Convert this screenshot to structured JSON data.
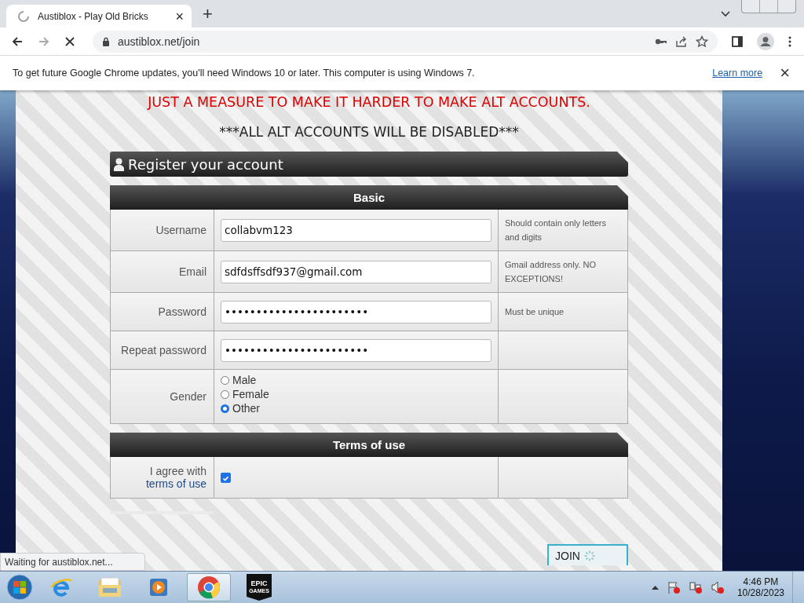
{
  "browser": {
    "tab": {
      "title": "Austiblox - Play Old Bricks",
      "loading": true,
      "close": "×"
    },
    "new_tab": "+",
    "url": "austiblox.net/join",
    "loading": true
  },
  "infobar": {
    "message": "To get future Google Chrome updates, you'll need Windows 10 or later. This computer is using Windows 7.",
    "link": "Learn more",
    "close": "×"
  },
  "page": {
    "notice_lines": [
      "JUST A MEASURE TO MAKE IT HARDER TO MAKE ALT ACCOUNTS."
    ],
    "warning": "***ALL ALT ACCOUNTS WILL BE DISABLED***",
    "panel_title": "Register your account",
    "sections": [
      {
        "title": "Basic",
        "rows": [
          {
            "kind": "text",
            "label": "Username",
            "value": "collabvm123",
            "hint": "Should contain only letters and digits"
          },
          {
            "kind": "text",
            "label": "Email",
            "value": "sdfdsffsdf937@gmail.com",
            "hint": "Gmail address only. NO EXCEPTIONS!"
          },
          {
            "kind": "text",
            "label": "Password",
            "value": "•••••••••••••••••••••••",
            "hint": "Must be unique"
          },
          {
            "kind": "text",
            "label": "Repeat password",
            "value": "•••••••••••••••••••••••"
          },
          {
            "kind": "radio",
            "label": "Gender",
            "options": [
              {
                "label": "Male",
                "selected": false
              },
              {
                "label": "Female",
                "selected": false
              },
              {
                "label": "Other",
                "selected": true
              }
            ]
          }
        ]
      },
      {
        "title": "Terms of use",
        "rows": [
          {
            "kind": "checkbox",
            "label": "I agree with",
            "link": "terms of use",
            "checked": true
          }
        ]
      }
    ],
    "join_button": {
      "label": "JOIN",
      "loading": true
    }
  },
  "status_bar": "Waiting for austiblox.net...",
  "taskbar": {
    "apps": [
      {
        "kind": "ie",
        "selected": false
      },
      {
        "kind": "explorer",
        "selected": false
      },
      {
        "kind": "media",
        "selected": false
      },
      {
        "kind": "chrome",
        "selected": true
      },
      {
        "kind": "epic",
        "selected": false,
        "lines": [
          "EPIC",
          "GAMES"
        ]
      }
    ],
    "time": "4:46 PM",
    "date": "10/28/2023"
  }
}
